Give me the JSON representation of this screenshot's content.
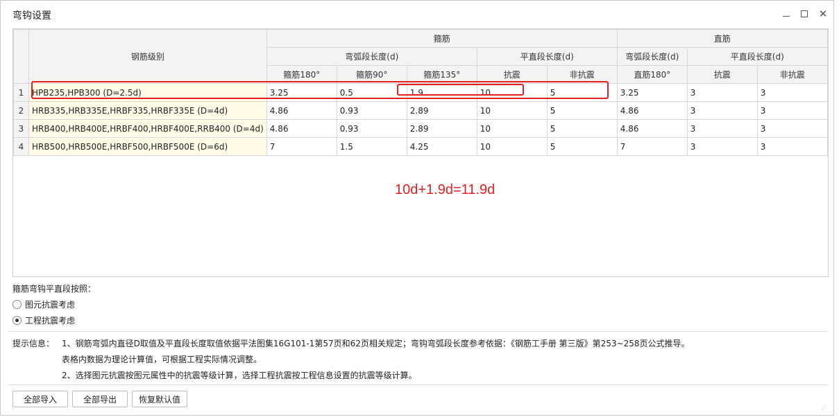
{
  "window": {
    "title": "弯钩设置"
  },
  "controls": {
    "minimize": "—",
    "maximize": "□",
    "close": "✕"
  },
  "table": {
    "header": {
      "grade": "钢筋级别",
      "stirrup": "箍筋",
      "straight": "直筋",
      "arc_len": "弯弧段长度(d)",
      "flat_len": "平直段长度(d)",
      "s180": "箍筋180°",
      "s90": "箍筋90°",
      "s135": "箍筋135°",
      "seismic": "抗震",
      "nonseismic": "非抗震",
      "straight_arc": "弯弧段长度(d)",
      "straight_flat": "平直段长度(d)",
      "z180": "直筋180°",
      "z_seismic": "抗震",
      "z_nonseismic": "非抗震"
    },
    "rows": [
      {
        "n": "1",
        "grade": "HPB235,HPB300 (D=2.5d)",
        "s180": "3.25",
        "s90": "0.5",
        "s135": "1.9",
        "seis": "10",
        "nonseis": "5",
        "z180": "3.25",
        "zseis": "3",
        "znonseis": "3"
      },
      {
        "n": "2",
        "grade": "HRB335,HRB335E,HRBF335,HRBF335E (D=4d)",
        "s180": "4.86",
        "s90": "0.93",
        "s135": "2.89",
        "seis": "10",
        "nonseis": "5",
        "z180": "4.86",
        "zseis": "3",
        "znonseis": "3"
      },
      {
        "n": "3",
        "grade": "HRB400,HRB400E,HRBF400,HRBF400E,RRB400 (D=4d)",
        "s180": "4.86",
        "s90": "0.93",
        "s135": "2.89",
        "seis": "10",
        "nonseis": "5",
        "z180": "4.86",
        "zseis": "3",
        "znonseis": "3"
      },
      {
        "n": "4",
        "grade": "HRB500,HRB500E,HRBF500,HRBF500E (D=6d)",
        "s180": "7",
        "s90": "1.5",
        "s135": "4.25",
        "seis": "10",
        "nonseis": "5",
        "z180": "7",
        "zseis": "3",
        "znonseis": "3"
      }
    ]
  },
  "annotation": {
    "formula": "10d+1.9d=11.9d",
    "color": "#e62020"
  },
  "options": {
    "label": "箍筋弯钩平直段按照：",
    "choices": [
      {
        "label": "图元抗震考虑",
        "selected": false
      },
      {
        "label": "工程抗震考虑",
        "selected": true
      }
    ]
  },
  "hint": {
    "prefix": "提示信息：",
    "line1": "1、钢筋弯弧内直径D取值及平直段长度取值依据平法图集16G101-1第57页和62页相关规定；弯钩弯弧段长度参考依据：《钢筋工手册  第三版》第253~258页公式推导。",
    "line2": "表格内数据为理论计算值，可根据工程实际情况调整。",
    "line3": "2、选择图元抗震按图元属性中的抗震等级计算，选择工程抗震按工程信息设置的抗震等级计算。"
  },
  "buttons": {
    "import_all": "全部导入",
    "export_all": "全部导出",
    "restore_default": "恢复默认值"
  }
}
